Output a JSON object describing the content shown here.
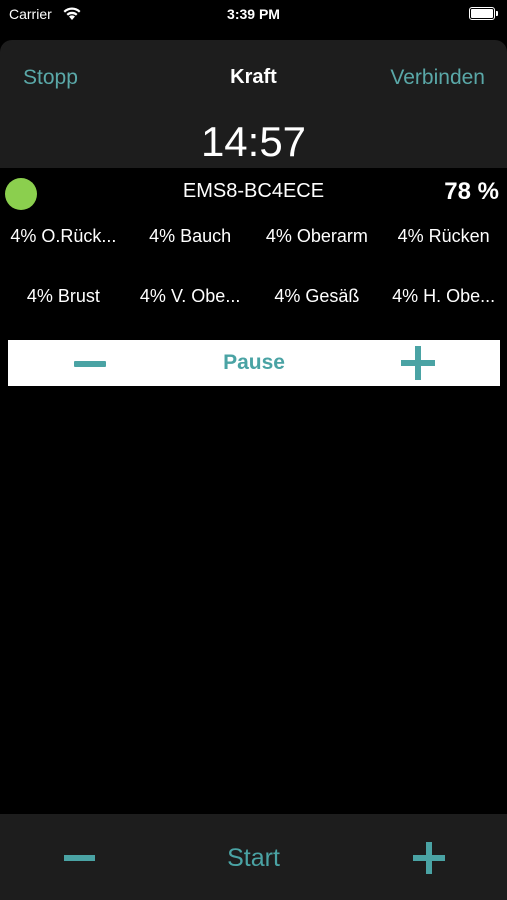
{
  "status_bar": {
    "carrier": "Carrier",
    "time": "3:39 PM"
  },
  "nav": {
    "left": "Stopp",
    "title": "Kraft",
    "right": "Verbinden"
  },
  "timer": "14:57",
  "device": {
    "name": "EMS8-BC4ECE",
    "battery": "78 %",
    "status_color": "#8bcf4e"
  },
  "channels": [
    "4% O.Rück...",
    "4% Bauch",
    "4% Oberarm",
    "4% Rücken",
    "4% Brust",
    "4% V. Obe...",
    "4% Gesäß",
    "4% H. Obe..."
  ],
  "control": {
    "label": "Pause",
    "minus_icon": "minus-icon",
    "plus_icon": "plus-icon"
  },
  "bottom": {
    "label": "Start",
    "minus_icon": "minus-icon",
    "plus_icon": "plus-icon"
  },
  "colors": {
    "accent": "#4aa3a4",
    "nav_accent": "#5aa8a8",
    "background": "#000000",
    "panel": "#1d1d1d"
  }
}
